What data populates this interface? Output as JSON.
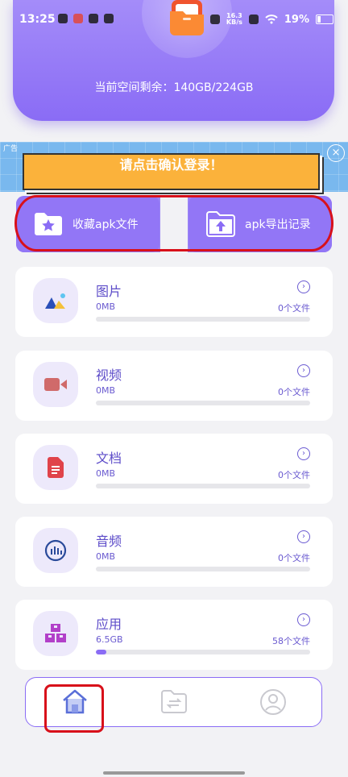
{
  "status_bar": {
    "time": "13:25",
    "net_speed_top": "16.3",
    "net_speed_bottom": "KB/s",
    "battery": "19%"
  },
  "header": {
    "storage_text": "当前空间剩余：140GB/224GB",
    "accent": "#8a6cf5"
  },
  "ad": {
    "label": "广告",
    "banner_text": "请点击确认登录！",
    "close_symbol": "×"
  },
  "quick_actions": {
    "favorites_label": "收藏apk文件",
    "export_label": "apk导出记录"
  },
  "categories": [
    {
      "title": "图片",
      "size": "0MB",
      "count": "0个文件",
      "progress": 0,
      "icon": "image-icon"
    },
    {
      "title": "视频",
      "size": "0MB",
      "count": "0个文件",
      "progress": 0,
      "icon": "video-icon"
    },
    {
      "title": "文档",
      "size": "0MB",
      "count": "0个文件",
      "progress": 0,
      "icon": "document-icon"
    },
    {
      "title": "音频",
      "size": "0MB",
      "count": "0个文件",
      "progress": 0,
      "icon": "audio-icon"
    },
    {
      "title": "应用",
      "size": "6.5GB",
      "count": "58个文件",
      "progress": 0.05,
      "icon": "apps-icon"
    }
  ],
  "bottom_nav": {
    "items": [
      "home-icon",
      "transfer-icon",
      "profile-icon"
    ],
    "active": "home-icon"
  }
}
